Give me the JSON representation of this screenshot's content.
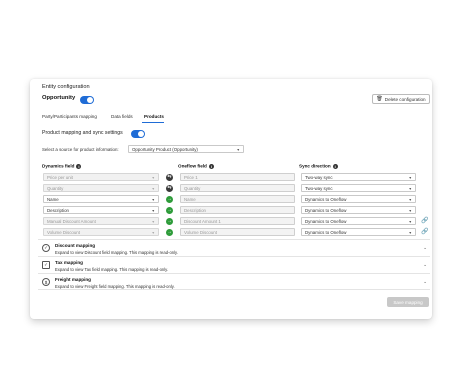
{
  "header": {
    "title": "Entity configuration"
  },
  "entity": {
    "name": "Opportunity",
    "enabled": true
  },
  "delete_button": {
    "icon": "trash-icon",
    "label": "Delete configuration"
  },
  "tabs": [
    {
      "label": "Party/Participants mapping",
      "active": false
    },
    {
      "label": "Data fields",
      "active": false
    },
    {
      "label": "Products",
      "active": true
    }
  ],
  "product_toggle": {
    "label": "Product mapping and sync settings",
    "enabled": true
  },
  "source": {
    "label": "Select a source for product information:",
    "value": "Opportunity Product (Opportunity)"
  },
  "columns": {
    "dynamics": "Dynamics field",
    "oneflow": "Oneflow field",
    "sync": "Sync direction"
  },
  "rows": [
    {
      "dynamics": "Price per unit",
      "oneflow": "Price 1",
      "sync": "Two-way sync",
      "direction": "both",
      "disabled": true,
      "link": false
    },
    {
      "dynamics": "Quantity",
      "oneflow": "Quantity",
      "sync": "Two-way sync",
      "direction": "both",
      "disabled": true,
      "link": false
    },
    {
      "dynamics": "Name",
      "oneflow": "Name",
      "sync": "Dynamics to Oneflow",
      "direction": "right",
      "disabled": false,
      "link": false
    },
    {
      "dynamics": "Description",
      "oneflow": "Description",
      "sync": "Dynamics to Oneflow",
      "direction": "right",
      "disabled": false,
      "link": false
    },
    {
      "dynamics": "Manual Discount Amount",
      "oneflow": "Discount Amount 1",
      "sync": "Dynamics to Oneflow",
      "direction": "right",
      "disabled": true,
      "link": true
    },
    {
      "dynamics": "Volume Discount",
      "oneflow": "Volume Discount",
      "sync": "Dynamics to Oneflow",
      "direction": "right",
      "disabled": true,
      "link": true
    }
  ],
  "sections": [
    {
      "icon": "discount-icon",
      "title": "Discount mapping",
      "desc": "Expand to view Discount field mapping. This mapping is read-only."
    },
    {
      "icon": "tax-icon",
      "title": "Tax mapping",
      "desc": "Expand to view Tax field mapping. This mapping is read-only."
    },
    {
      "icon": "freight-icon",
      "title": "Freight mapping",
      "desc": "Expand to view Freight field mapping. This mapping is read-only."
    }
  ],
  "save_button": {
    "label": "Save mapping"
  },
  "colors": {
    "accent": "#1f6cd6",
    "sync_right": "#2e9c3a",
    "sync_both": "#3a3a3a"
  }
}
